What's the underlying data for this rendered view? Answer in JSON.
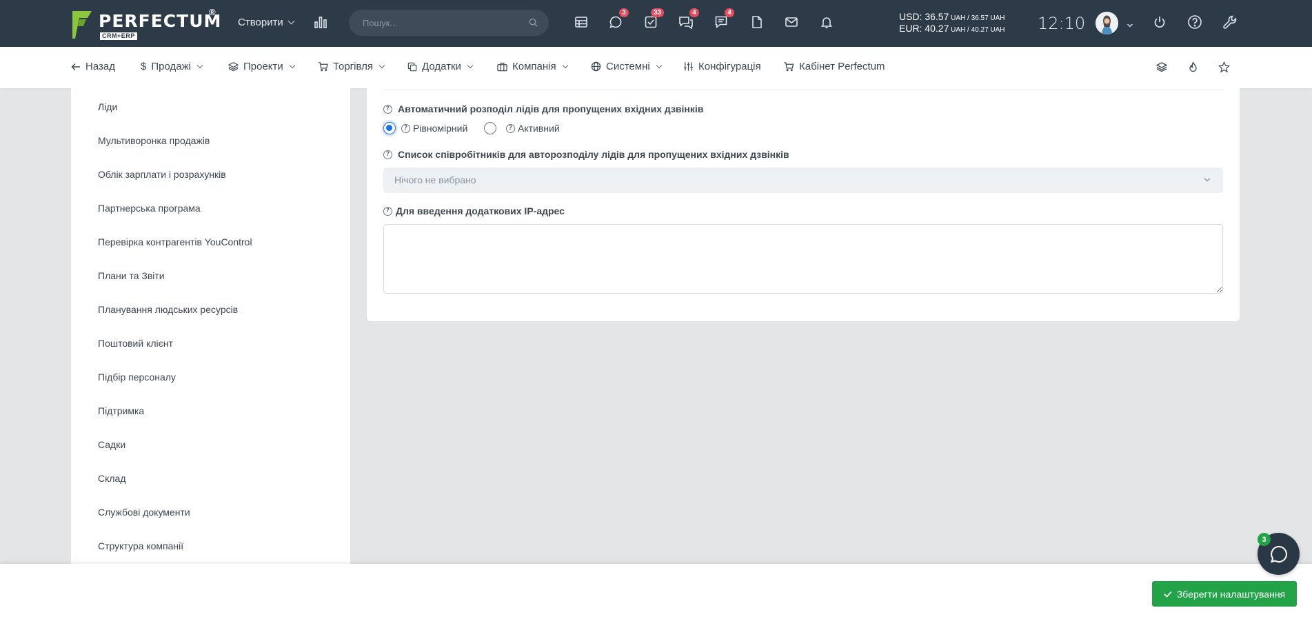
{
  "brand": {
    "name": "PERFECTUM",
    "reg": "®",
    "sub": "CRM+ERP"
  },
  "header": {
    "create_label": "Створити",
    "search_placeholder": "Пошук...",
    "badges": {
      "chat": "3",
      "tasks": "33",
      "comments": "4",
      "messages": "4"
    },
    "rates": {
      "usd_prefix": "USD: 36.57",
      "usd_mid": " UAH / 36.57",
      "usd_suffix": " UAH",
      "eur_prefix": "EUR: 40.27",
      "eur_mid": " UAH / 40.27",
      "eur_suffix": " UAH"
    },
    "clock": "12:10"
  },
  "nav": {
    "back": "Назад",
    "sales": "Продажі",
    "projects": "Проекти",
    "trade": "Торгівля",
    "addons": "Додатки",
    "company": "Компанія",
    "system": "Системні",
    "config": "Конфігурація",
    "cabinet": "Кабінет Perfectum"
  },
  "sidebar": {
    "items": [
      {
        "label": "Ліди"
      },
      {
        "label": "Мультиворонка продажів"
      },
      {
        "label": "Облік зарплати і розрахунків"
      },
      {
        "label": "Партнерська програма"
      },
      {
        "label": "Перевірка контрагентів YouControl"
      },
      {
        "label": "Плани та Звіти"
      },
      {
        "label": "Планування людських ресурсів"
      },
      {
        "label": "Поштовий клієнт"
      },
      {
        "label": "Підбір персоналу"
      },
      {
        "label": "Підтримка"
      },
      {
        "label": "Садки"
      },
      {
        "label": "Склад"
      },
      {
        "label": "Службові документи"
      },
      {
        "label": "Структура компанії"
      }
    ]
  },
  "form": {
    "auto_dist_label": "Автоматичний розподіл лідів для пропущених вхідних дзвінків",
    "radio_even": "Рівномірний",
    "radio_active": "Активний",
    "selected_option": "Рівномірний",
    "staff_list_label": "Список співробітників для авторозподілу лідів для пропущених вхідних дзвінків",
    "staff_select_value": "Нічого не вибрано",
    "ip_label": "Для введення додаткових IP-адрес",
    "ip_value": ""
  },
  "footer": {
    "save_label": "Зберегти налаштування",
    "chat_badge": "3"
  },
  "colors": {
    "topbar": "#2d3a48",
    "accent_blue": "#1f6fd6",
    "save_green": "#22a348",
    "badge_red": "#e14c5f"
  }
}
